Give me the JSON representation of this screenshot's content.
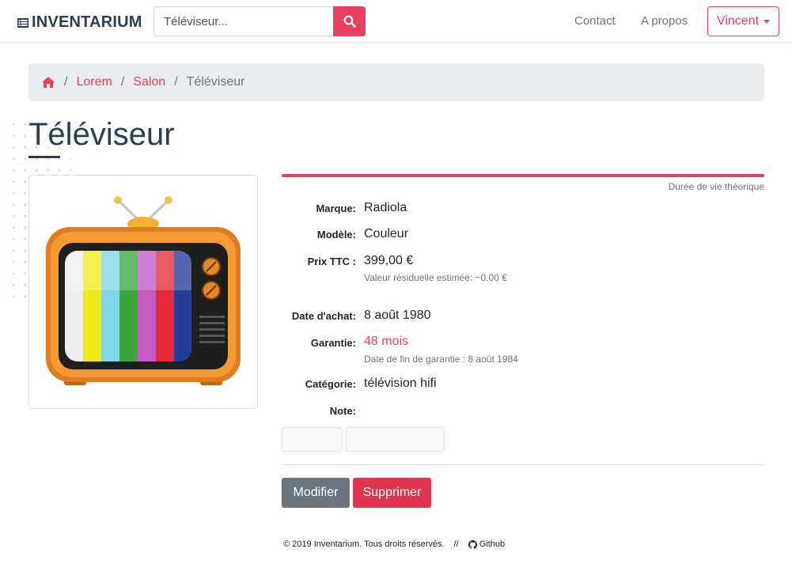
{
  "navbar": {
    "brand": "INVENTARIUM",
    "search_placeholder": "Téléviseur...",
    "links": [
      "Contact",
      "A propos"
    ],
    "user": "Vincent"
  },
  "breadcrumb": {
    "items": [
      "Lorem",
      "Salon"
    ],
    "active": "Téléviseur"
  },
  "page": {
    "title": "Téléviseur"
  },
  "lifespan": {
    "label": "Durée de vie théorique",
    "fraction": 1.0
  },
  "details": {
    "brand_label": "Marque:",
    "brand_value": "Radiola",
    "model_label": "Modèle:",
    "model_value": "Couleur",
    "price_label": "Prix TTC :",
    "price_value": "399,00 €",
    "residual": "Valeur résiduelle estimée: ~0.00 €",
    "purchase_label": "Date d'achat:",
    "purchase_value": "8 août 1980",
    "warranty_label": "Garantie:",
    "warranty_value": "48 mois",
    "warranty_end": "Date de fin de garantie : 8 août 1984",
    "category_label": "Catégorie:",
    "category_value": "télévision hifi",
    "note_label": "Note:"
  },
  "actions": {
    "edit": "Modifier",
    "delete": "Supprimer"
  },
  "footer": {
    "copyright": "© 2019 Inventarium. Tous droits réservés.",
    "sep": "//",
    "github": "Github"
  },
  "colors": {
    "accent": "#e83e5f",
    "dark": "#2c3e50",
    "muted": "#6c757d"
  }
}
